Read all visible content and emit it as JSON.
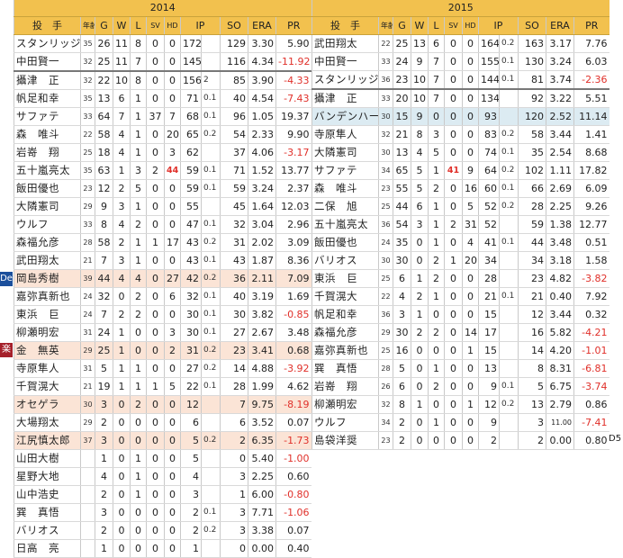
{
  "headers": {
    "name": "投　手",
    "age": "年齢",
    "g": "G",
    "w": "W",
    "l": "L",
    "sv": "SV",
    "hd": "HD",
    "ip": "IP",
    "so": "SO",
    "era": "ERA",
    "pr": "PR"
  },
  "left": {
    "year": "2014",
    "rows": [
      {
        "name": "スタンリッジ",
        "age": "35",
        "g": "26",
        "w": "11",
        "l": "8",
        "sv": "0",
        "hd": "0",
        "ip": "172",
        "ipf": "",
        "so": "129",
        "era": "3.30",
        "pr": "5.90"
      },
      {
        "name": "中田賢一",
        "age": "32",
        "g": "25",
        "w": "11",
        "l": "7",
        "sv": "0",
        "hd": "0",
        "ip": "145",
        "ipf": "",
        "so": "116",
        "era": "4.34",
        "pr": "-11.92"
      },
      {
        "name": "攝津　正",
        "age": "32",
        "g": "22",
        "w": "10",
        "l": "8",
        "sv": "0",
        "hd": "0",
        "ip": "156",
        "ipf": "2",
        "so": "85",
        "era": "3.90",
        "pr": "-4.33"
      },
      {
        "name": "帆足和幸",
        "age": "35",
        "g": "13",
        "w": "6",
        "l": "1",
        "sv": "0",
        "hd": "0",
        "ip": "71",
        "ipf": "0.1",
        "so": "40",
        "era": "4.54",
        "pr": "-7.43"
      },
      {
        "name": "サファテ",
        "age": "33",
        "g": "64",
        "w": "7",
        "l": "1",
        "sv": "37",
        "hd": "7",
        "ip": "68",
        "ipf": "0.1",
        "so": "96",
        "era": "1.05",
        "pr": "19.37"
      },
      {
        "name": "森　唯斗",
        "age": "22",
        "g": "58",
        "w": "4",
        "l": "1",
        "sv": "0",
        "hd": "20",
        "ip": "65",
        "ipf": "0.2",
        "so": "54",
        "era": "2.33",
        "pr": "9.90"
      },
      {
        "name": "岩嵜　翔",
        "age": "25",
        "g": "18",
        "w": "4",
        "l": "1",
        "sv": "0",
        "hd": "3",
        "ip": "62",
        "ipf": "",
        "so": "37",
        "era": "4.06",
        "pr": "-3.17"
      },
      {
        "name": "五十嵐亮太",
        "age": "35",
        "g": "63",
        "w": "1",
        "l": "3",
        "sv": "2",
        "hd": "44",
        "ip": "59",
        "ipf": "0.1",
        "so": "71",
        "era": "1.52",
        "pr": "13.77"
      },
      {
        "name": "飯田優也",
        "age": "23",
        "g": "12",
        "w": "2",
        "l": "5",
        "sv": "0",
        "hd": "0",
        "ip": "59",
        "ipf": "0.1",
        "so": "59",
        "era": "3.24",
        "pr": "2.37"
      },
      {
        "name": "大隣憲司",
        "age": "29",
        "g": "9",
        "w": "3",
        "l": "1",
        "sv": "0",
        "hd": "0",
        "ip": "55",
        "ipf": "",
        "so": "45",
        "era": "1.64",
        "pr": "12.03"
      },
      {
        "name": "ウルフ",
        "age": "33",
        "g": "8",
        "w": "4",
        "l": "2",
        "sv": "0",
        "hd": "0",
        "ip": "47",
        "ipf": "0.1",
        "so": "32",
        "era": "3.04",
        "pr": "2.96"
      },
      {
        "name": "森福允彦",
        "age": "28",
        "g": "58",
        "w": "2",
        "l": "1",
        "sv": "1",
        "hd": "17",
        "ip": "43",
        "ipf": "0.2",
        "so": "31",
        "era": "2.02",
        "pr": "3.09"
      },
      {
        "name": "武田翔太",
        "age": "21",
        "g": "7",
        "w": "3",
        "l": "1",
        "sv": "0",
        "hd": "0",
        "ip": "43",
        "ipf": "0.1",
        "so": "43",
        "era": "1.87",
        "pr": "8.36"
      },
      {
        "name": "岡島秀樹",
        "age": "39",
        "g": "44",
        "w": "4",
        "l": "4",
        "sv": "0",
        "hd": "27",
        "ip": "42",
        "ipf": "0.2",
        "so": "36",
        "era": "2.11",
        "pr": "7.09",
        "hl": true
      },
      {
        "name": "嘉弥真新也",
        "age": "24",
        "g": "32",
        "w": "0",
        "l": "2",
        "sv": "0",
        "hd": "6",
        "ip": "32",
        "ipf": "0.1",
        "so": "40",
        "era": "3.19",
        "pr": "1.69"
      },
      {
        "name": "東浜　巨",
        "age": "24",
        "g": "7",
        "w": "2",
        "l": "2",
        "sv": "0",
        "hd": "0",
        "ip": "30",
        "ipf": "0.1",
        "so": "30",
        "era": "3.82",
        "pr": "-0.85"
      },
      {
        "name": "柳瀬明宏",
        "age": "31",
        "g": "24",
        "w": "1",
        "l": "0",
        "sv": "0",
        "hd": "3",
        "ip": "30",
        "ipf": "0.1",
        "so": "27",
        "era": "2.67",
        "pr": "3.48"
      },
      {
        "name": "金　無英",
        "age": "29",
        "g": "25",
        "w": "1",
        "l": "0",
        "sv": "0",
        "hd": "2",
        "ip": "31",
        "ipf": "0.2",
        "so": "23",
        "era": "3.41",
        "pr": "0.68",
        "hl": true
      },
      {
        "name": "寺原隼人",
        "age": "31",
        "g": "5",
        "w": "1",
        "l": "1",
        "sv": "0",
        "hd": "0",
        "ip": "27",
        "ipf": "0.2",
        "so": "14",
        "era": "4.88",
        "pr": "-3.92"
      },
      {
        "name": "千賀滉大",
        "age": "21",
        "g": "19",
        "w": "1",
        "l": "1",
        "sv": "1",
        "hd": "5",
        "ip": "22",
        "ipf": "0.1",
        "so": "28",
        "era": "1.99",
        "pr": "4.62"
      },
      {
        "name": "オセゲラ",
        "age": "30",
        "g": "3",
        "w": "0",
        "l": "2",
        "sv": "0",
        "hd": "0",
        "ip": "12",
        "ipf": "",
        "so": "7",
        "era": "9.75",
        "pr": "-8.19",
        "hl": true
      },
      {
        "name": "大場翔太",
        "age": "29",
        "g": "2",
        "w": "0",
        "l": "0",
        "sv": "0",
        "hd": "0",
        "ip": "6",
        "ipf": "",
        "so": "6",
        "era": "3.52",
        "pr": "0.07"
      },
      {
        "name": "江尻慎太郎",
        "age": "37",
        "g": "3",
        "w": "0",
        "l": "0",
        "sv": "0",
        "hd": "0",
        "ip": "5",
        "ipf": "0.2",
        "so": "2",
        "era": "6.35",
        "pr": "-1.73",
        "hl": true
      },
      {
        "name": "山田大樹",
        "age": "",
        "g": "1",
        "w": "0",
        "l": "1",
        "sv": "0",
        "hd": "0",
        "ip": "5",
        "ipf": "",
        "so": "0",
        "era": "5.40",
        "pr": "-1.00"
      },
      {
        "name": "星野大地",
        "age": "",
        "g": "4",
        "w": "0",
        "l": "1",
        "sv": "0",
        "hd": "0",
        "ip": "4",
        "ipf": "",
        "so": "3",
        "era": "2.25",
        "pr": "0.60"
      },
      {
        "name": "山中浩史",
        "age": "",
        "g": "2",
        "w": "0",
        "l": "1",
        "sv": "0",
        "hd": "0",
        "ip": "3",
        "ipf": "",
        "so": "1",
        "era": "6.00",
        "pr": "-0.80"
      },
      {
        "name": "巽　真悟",
        "age": "",
        "g": "3",
        "w": "0",
        "l": "0",
        "sv": "0",
        "hd": "0",
        "ip": "2",
        "ipf": "0.1",
        "so": "3",
        "era": "7.71",
        "pr": "-1.06"
      },
      {
        "name": "バリオス",
        "age": "",
        "g": "2",
        "w": "0",
        "l": "0",
        "sv": "0",
        "hd": "0",
        "ip": "2",
        "ipf": "0.2",
        "so": "3",
        "era": "3.38",
        "pr": "0.07"
      },
      {
        "name": "日高　亮",
        "age": "",
        "g": "1",
        "w": "0",
        "l": "0",
        "sv": "0",
        "hd": "0",
        "ip": "1",
        "ipf": "",
        "so": "0",
        "era": "0.00",
        "pr": "0.40"
      }
    ]
  },
  "right": {
    "year": "2015",
    "rows": [
      {
        "name": "武田翔太",
        "age": "22",
        "g": "25",
        "w": "13",
        "l": "6",
        "sv": "0",
        "hd": "0",
        "ip": "164",
        "ipf": "0.2",
        "so": "163",
        "era": "3.17",
        "pr": "7.76"
      },
      {
        "name": "中田賢一",
        "age": "33",
        "g": "24",
        "w": "9",
        "l": "7",
        "sv": "0",
        "hd": "0",
        "ip": "155",
        "ipf": "0.1",
        "so": "130",
        "era": "3.24",
        "pr": "6.03"
      },
      {
        "name": "スタンリッジ",
        "age": "36",
        "g": "23",
        "w": "10",
        "l": "7",
        "sv": "0",
        "hd": "0",
        "ip": "144",
        "ipf": "0.1",
        "so": "81",
        "era": "3.74",
        "pr": "-2.36"
      },
      {
        "name": "攝津　正",
        "age": "33",
        "g": "20",
        "w": "10",
        "l": "7",
        "sv": "0",
        "hd": "0",
        "ip": "134",
        "ipf": "",
        "so": "92",
        "era": "3.22",
        "pr": "5.51"
      },
      {
        "name": "バンデンハーク",
        "age": "30",
        "g": "15",
        "w": "9",
        "l": "0",
        "sv": "0",
        "hd": "0",
        "ip": "93",
        "ipf": "",
        "so": "120",
        "era": "2.52",
        "pr": "11.14",
        "bl": true
      },
      {
        "name": "寺原隼人",
        "age": "32",
        "g": "21",
        "w": "8",
        "l": "3",
        "sv": "0",
        "hd": "0",
        "ip": "83",
        "ipf": "0.2",
        "so": "58",
        "era": "3.44",
        "pr": "1.41"
      },
      {
        "name": "大隣憲司",
        "age": "30",
        "g": "13",
        "w": "4",
        "l": "5",
        "sv": "0",
        "hd": "0",
        "ip": "74",
        "ipf": "0.1",
        "so": "35",
        "era": "2.54",
        "pr": "8.68"
      },
      {
        "name": "サファテ",
        "age": "34",
        "g": "65",
        "w": "5",
        "l": "1",
        "sv": "41",
        "hd": "9",
        "ip": "64",
        "ipf": "0.2",
        "so": "102",
        "era": "1.11",
        "pr": "17.82"
      },
      {
        "name": "森　唯斗",
        "age": "23",
        "g": "55",
        "w": "5",
        "l": "2",
        "sv": "0",
        "hd": "16",
        "ip": "60",
        "ipf": "0.1",
        "so": "66",
        "era": "2.69",
        "pr": "6.09"
      },
      {
        "name": "二保　旭",
        "age": "25",
        "g": "44",
        "w": "6",
        "l": "1",
        "sv": "0",
        "hd": "5",
        "ip": "52",
        "ipf": "0.2",
        "so": "28",
        "era": "2.25",
        "pr": "9.26"
      },
      {
        "name": "五十嵐亮太",
        "age": "36",
        "g": "54",
        "w": "3",
        "l": "1",
        "sv": "2",
        "hd": "31",
        "ip": "52",
        "ipf": "",
        "so": "59",
        "era": "1.38",
        "pr": "12.77"
      },
      {
        "name": "飯田優也",
        "age": "24",
        "g": "35",
        "w": "0",
        "l": "1",
        "sv": "0",
        "hd": "4",
        "ip": "41",
        "ipf": "0.1",
        "so": "44",
        "era": "3.48",
        "pr": "0.51"
      },
      {
        "name": "バリオス",
        "age": "30",
        "g": "30",
        "w": "0",
        "l": "2",
        "sv": "1",
        "hd": "20",
        "ip": "34",
        "ipf": "",
        "so": "34",
        "era": "3.18",
        "pr": "1.58"
      },
      {
        "name": "東浜　巨",
        "age": "25",
        "g": "6",
        "w": "1",
        "l": "2",
        "sv": "0",
        "hd": "0",
        "ip": "28",
        "ipf": "",
        "so": "23",
        "era": "4.82",
        "pr": "-3.82"
      },
      {
        "name": "千賀滉大",
        "age": "22",
        "g": "4",
        "w": "2",
        "l": "1",
        "sv": "0",
        "hd": "0",
        "ip": "21",
        "ipf": "0.1",
        "so": "21",
        "era": "0.40",
        "pr": "7.92"
      },
      {
        "name": "帆足和幸",
        "age": "36",
        "g": "3",
        "w": "1",
        "l": "0",
        "sv": "0",
        "hd": "0",
        "ip": "15",
        "ipf": "",
        "so": "12",
        "era": "3.44",
        "pr": "0.32"
      },
      {
        "name": "森福允彦",
        "age": "29",
        "g": "30",
        "w": "2",
        "l": "2",
        "sv": "0",
        "hd": "14",
        "ip": "17",
        "ipf": "",
        "so": "16",
        "era": "5.82",
        "pr": "-4.21"
      },
      {
        "name": "嘉弥真新也",
        "age": "25",
        "g": "16",
        "w": "0",
        "l": "0",
        "sv": "0",
        "hd": "1",
        "ip": "15",
        "ipf": "",
        "so": "14",
        "era": "4.20",
        "pr": "-1.01"
      },
      {
        "name": "巽　真悟",
        "age": "28",
        "g": "5",
        "w": "0",
        "l": "1",
        "sv": "0",
        "hd": "0",
        "ip": "13",
        "ipf": "",
        "so": "8",
        "era": "8.31",
        "pr": "-6.81"
      },
      {
        "name": "岩嵜　翔",
        "age": "26",
        "g": "6",
        "w": "0",
        "l": "2",
        "sv": "0",
        "hd": "0",
        "ip": "9",
        "ipf": "0.1",
        "so": "5",
        "era": "6.75",
        "pr": "-3.74"
      },
      {
        "name": "柳瀬明宏",
        "age": "32",
        "g": "8",
        "w": "1",
        "l": "0",
        "sv": "0",
        "hd": "1",
        "ip": "12",
        "ipf": "0.2",
        "so": "13",
        "era": "2.79",
        "pr": "0.86"
      },
      {
        "name": "ウルフ",
        "age": "34",
        "g": "2",
        "w": "0",
        "l": "1",
        "sv": "0",
        "hd": "0",
        "ip": "9",
        "ipf": "",
        "so": "3",
        "era": "11.00",
        "pr": "-7.41"
      },
      {
        "name": "島袋洋奨",
        "age": "23",
        "g": "2",
        "w": "0",
        "l": "0",
        "sv": "0",
        "hd": "0",
        "ip": "2",
        "ipf": "",
        "so": "2",
        "era": "0.00",
        "pr": "0.80"
      }
    ]
  },
  "side_labels": {
    "de": "De",
    "rak": "楽",
    "d5": "D5"
  },
  "colors": {
    "header": "#f2c14e",
    "highlight": "#fbe4d6",
    "blue_highlight": "#dcebf2",
    "negative": "#e0302a"
  }
}
